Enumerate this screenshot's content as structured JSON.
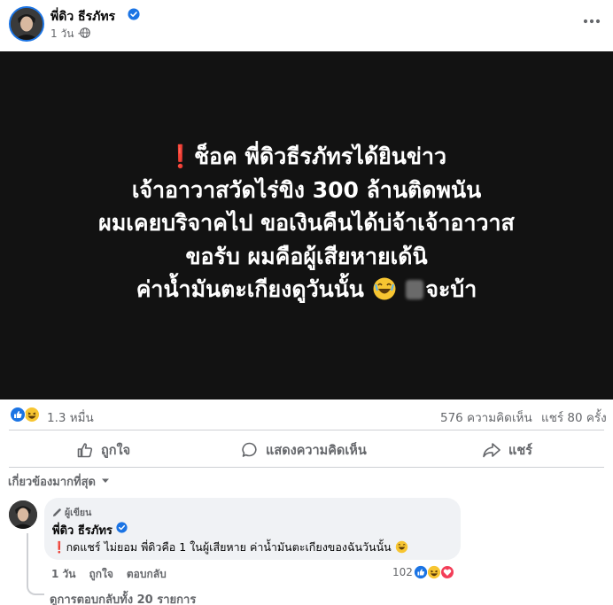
{
  "post": {
    "author": "พี่ดิว ธีรภัทร",
    "time": "1 วัน ·",
    "image_text": {
      "line1": "ช็อค พี่ดิวธีรภัทรได้ยินข่าว",
      "line2": "เจ้าอาวาสวัดไร่ขิง 300 ล้านติดพนัน",
      "line3": "ผมเคยบริจาคไป ขอเงินคืนได้บ่จ้าเจ้าอาวาส",
      "line4": "ขอรับ ผมคือผู้เสียหายเด้นิ",
      "line5a": "ค่าน้ำมันตะเกียงดูวันนั้น",
      "line5b": "จะบ้า"
    },
    "reaction_count": "1.3 หมื่น",
    "comment_count": "576 ความคิดเห็น",
    "share_count": "แชร์ 80 ครั้ง"
  },
  "actions": {
    "like": "ถูกใจ",
    "comment": "แสดงความคิดเห็น",
    "share": "แชร์"
  },
  "filter": {
    "label": "เกี่ยวข้องมากที่สุด"
  },
  "comment": {
    "badge": "ผู้เขียน",
    "author": "พี่ดิว ธีรภัทร",
    "text": "กดแชร์ ไม่ยอม พี่ดิวคือ 1 ในผู้เสียหาย ค่าน้ำมันตะเกียงของฉันวันนั้น",
    "time": "1 วัน",
    "like": "ถูกใจ",
    "reply": "ตอบกลับ",
    "reaction_count": "102",
    "view_replies": "ดูการตอบกลับทั้ง 20 รายการ"
  },
  "colors": {
    "brand_blue": "#1b74e4",
    "muted": "#65676b",
    "bubble": "#f0f2f5",
    "image_bg": "#121212",
    "exclamation": "#e0262e"
  }
}
